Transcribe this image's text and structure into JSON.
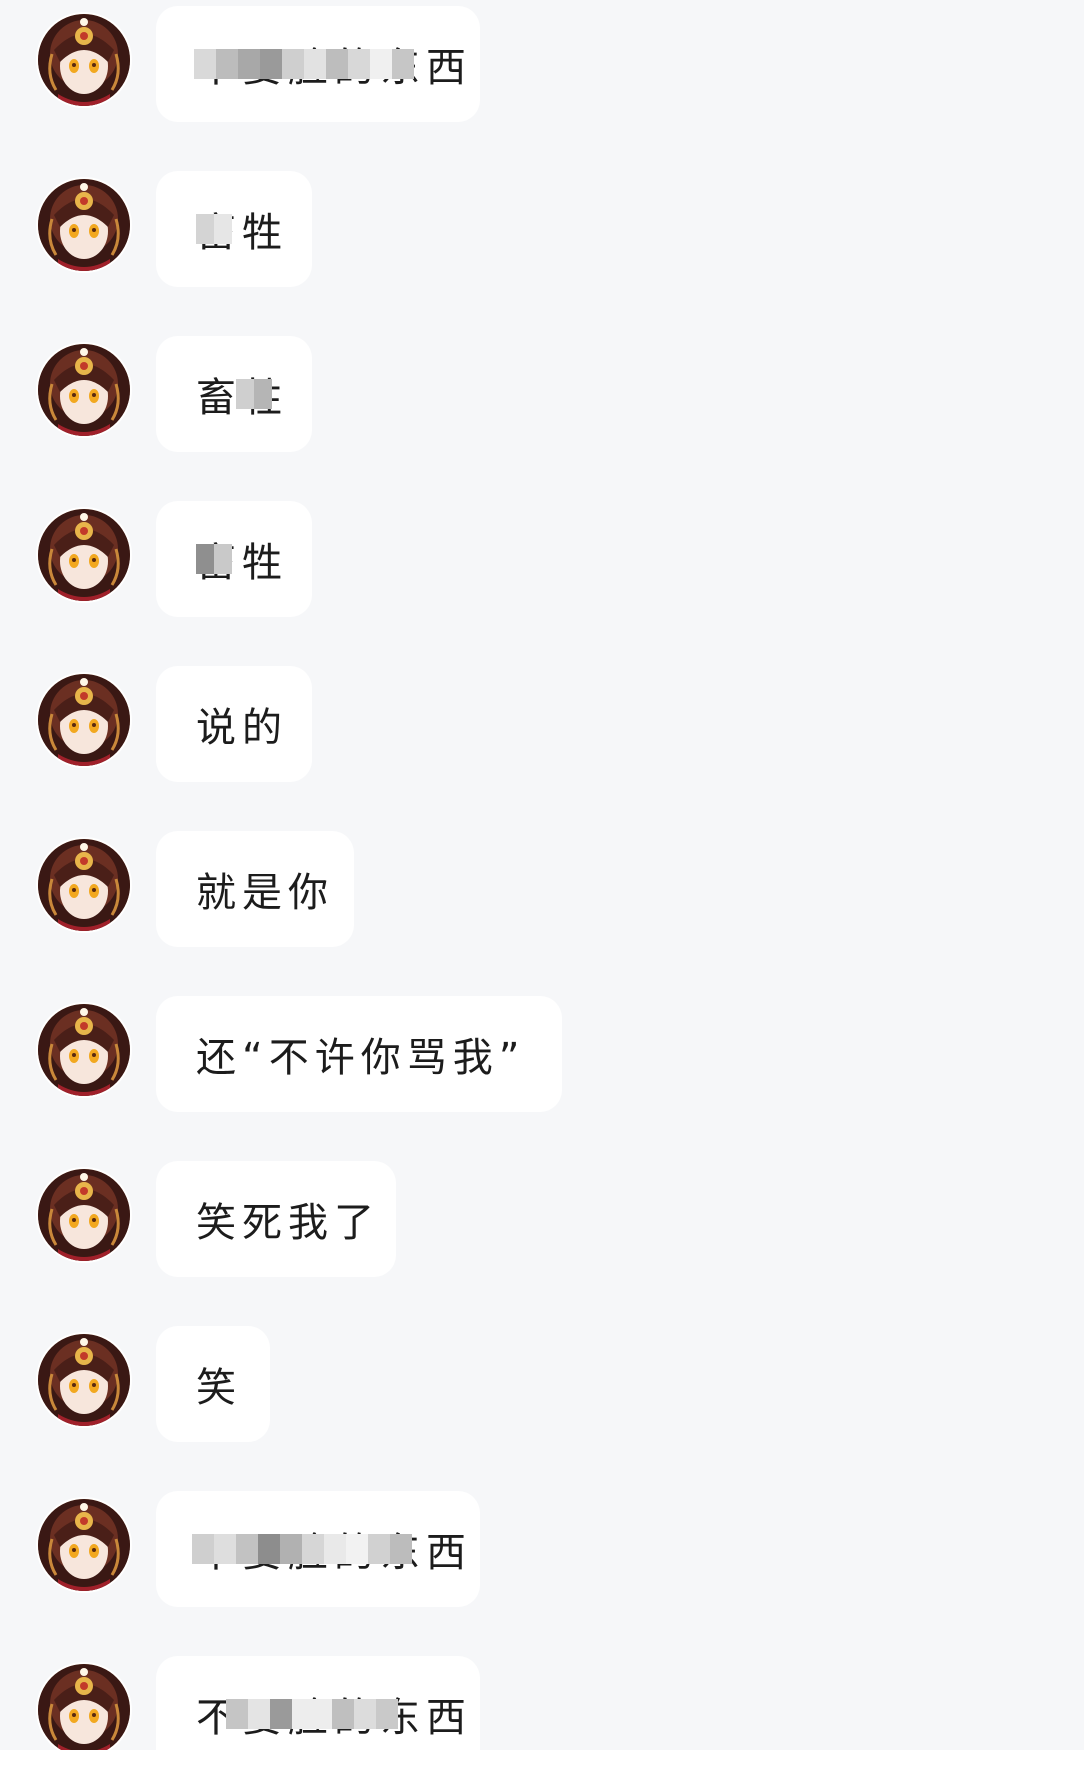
{
  "messages": [
    {
      "text": "不要脸的东西"
    },
    {
      "text": "畜牲"
    },
    {
      "text": "畜牲"
    },
    {
      "text": "畜牲"
    },
    {
      "text": "说的"
    },
    {
      "text": "就是你"
    },
    {
      "text": "还“不许你骂我”"
    },
    {
      "text": "笑死我了"
    },
    {
      "text": "笑"
    },
    {
      "text": "不要脸的东西"
    },
    {
      "text": "不要脸的东西"
    }
  ],
  "avatar": {
    "icon": "anime-girl-avatar-icon"
  },
  "colors": {
    "background": "#f6f7f9",
    "bubble": "#ffffff",
    "text": "#1c1c1c"
  }
}
